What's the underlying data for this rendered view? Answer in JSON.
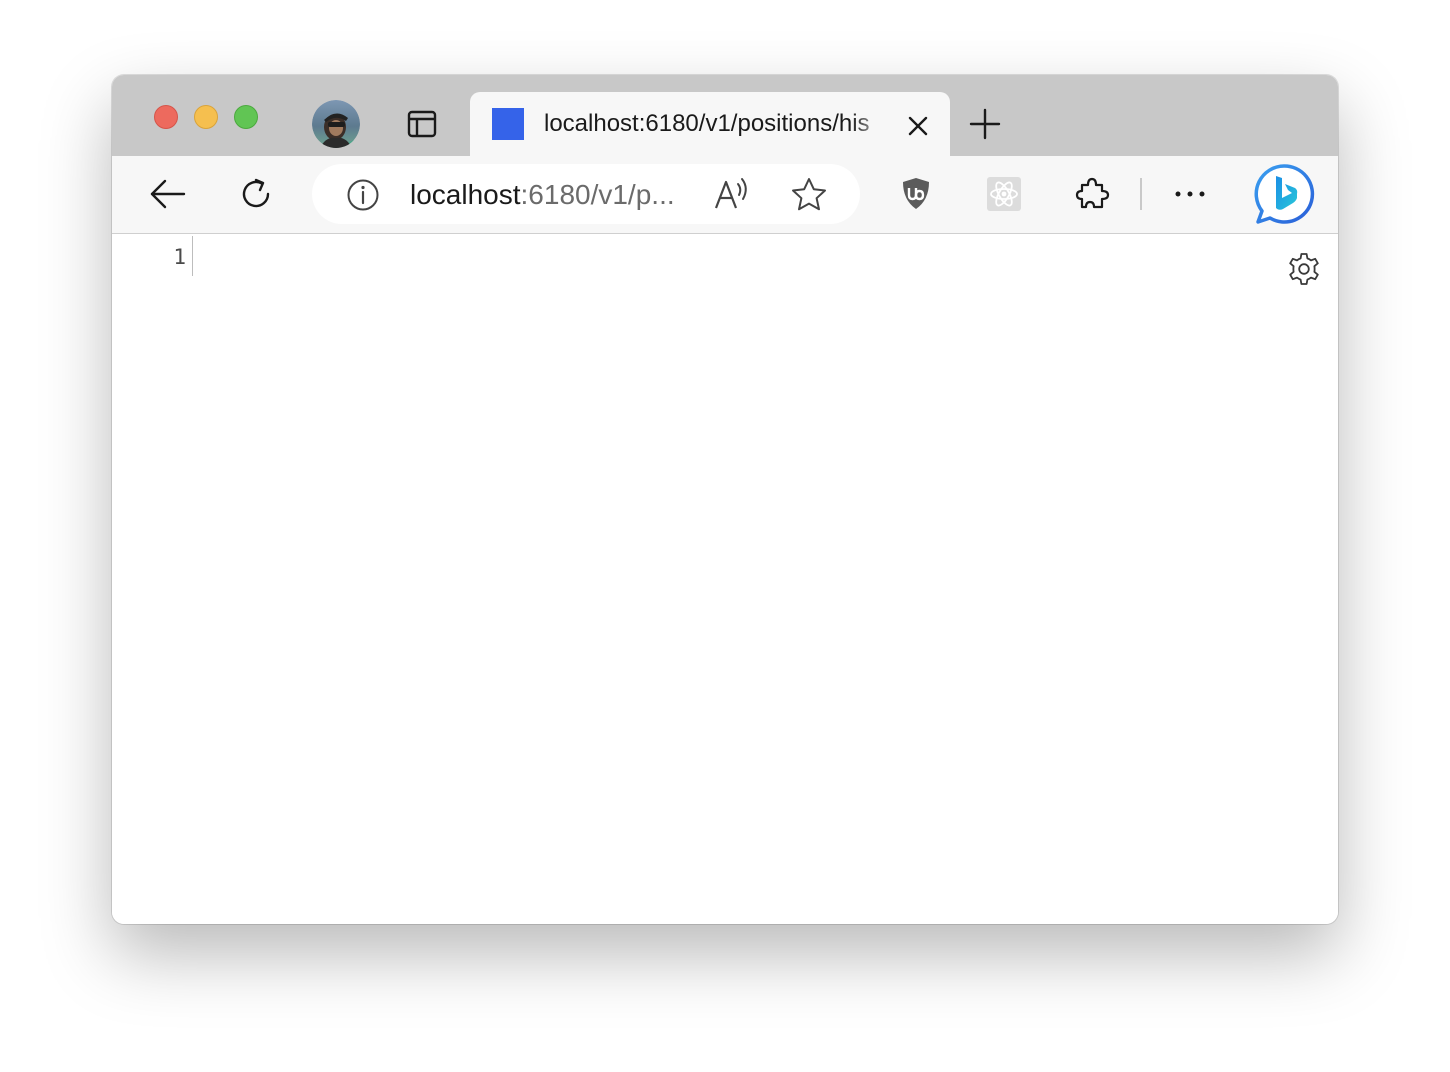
{
  "window": {
    "traffic_lights": [
      "close",
      "minimize",
      "zoom"
    ]
  },
  "tabbar": {
    "profile_icon": "profile-avatar-icon",
    "tab_actions_icon": "tab-actions-icon",
    "active_tab": {
      "title": "localhost:6180/v1/positions/his",
      "favicon_color": "#3563e9",
      "close_icon": "close-icon"
    },
    "new_tab_icon": "plus-icon"
  },
  "toolbar": {
    "back_icon": "back-arrow-icon",
    "refresh_icon": "refresh-icon",
    "address": {
      "host": "localhost",
      "path": ":6180/v1/p...",
      "info_icon": "info-icon",
      "read_aloud_icon": "read-aloud-icon",
      "favorite_icon": "star-icon"
    },
    "extensions": [
      "ublock-origin-icon",
      "react-devtools-icon",
      "extensions-puzzle-icon"
    ],
    "more_icon": "more-ellipsis-icon",
    "copilot_icon": "bing-copilot-icon"
  },
  "content": {
    "line_numbers": [
      "1"
    ],
    "settings_icon": "gear-icon"
  },
  "colors": {
    "tabbar_bg": "#c8c8c8",
    "toolbar_bg": "#f7f7f7",
    "accent_blue": "#3563e9"
  }
}
